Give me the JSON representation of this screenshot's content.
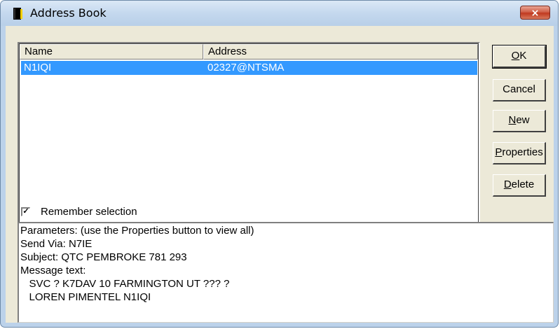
{
  "window": {
    "title": "Address Book",
    "close_glyph": "×"
  },
  "list": {
    "columns": [
      "Name",
      "Address"
    ],
    "rows": [
      {
        "name": "N1IQI",
        "address": "02327@NTSMA",
        "selected": true
      }
    ]
  },
  "buttons": {
    "ok": "OK",
    "cancel": "Cancel",
    "new": "New",
    "properties": "Properties",
    "delete": "Delete"
  },
  "remember": {
    "label": "Remember selection",
    "checked": true,
    "mark": "✓"
  },
  "details": {
    "lines": [
      "Parameters: (use the Properties button to view all)",
      "Send Via: N7IE",
      "Subject: QTC PEMBROKE 781 293",
      "Message text:",
      "   SVC ? K7DAV 10 FARMINGTON UT ??? ?",
      "   LOREN PIMENTEL N1IQI"
    ]
  },
  "colors": {
    "selection": "#3399ff",
    "window_frame": "#bcd2ea",
    "dialog_face": "#ece9d8",
    "close_button": "#c03a20"
  },
  "icons": {
    "title": "address-book-icon",
    "close": "close-icon",
    "check": "checkmark-icon"
  }
}
